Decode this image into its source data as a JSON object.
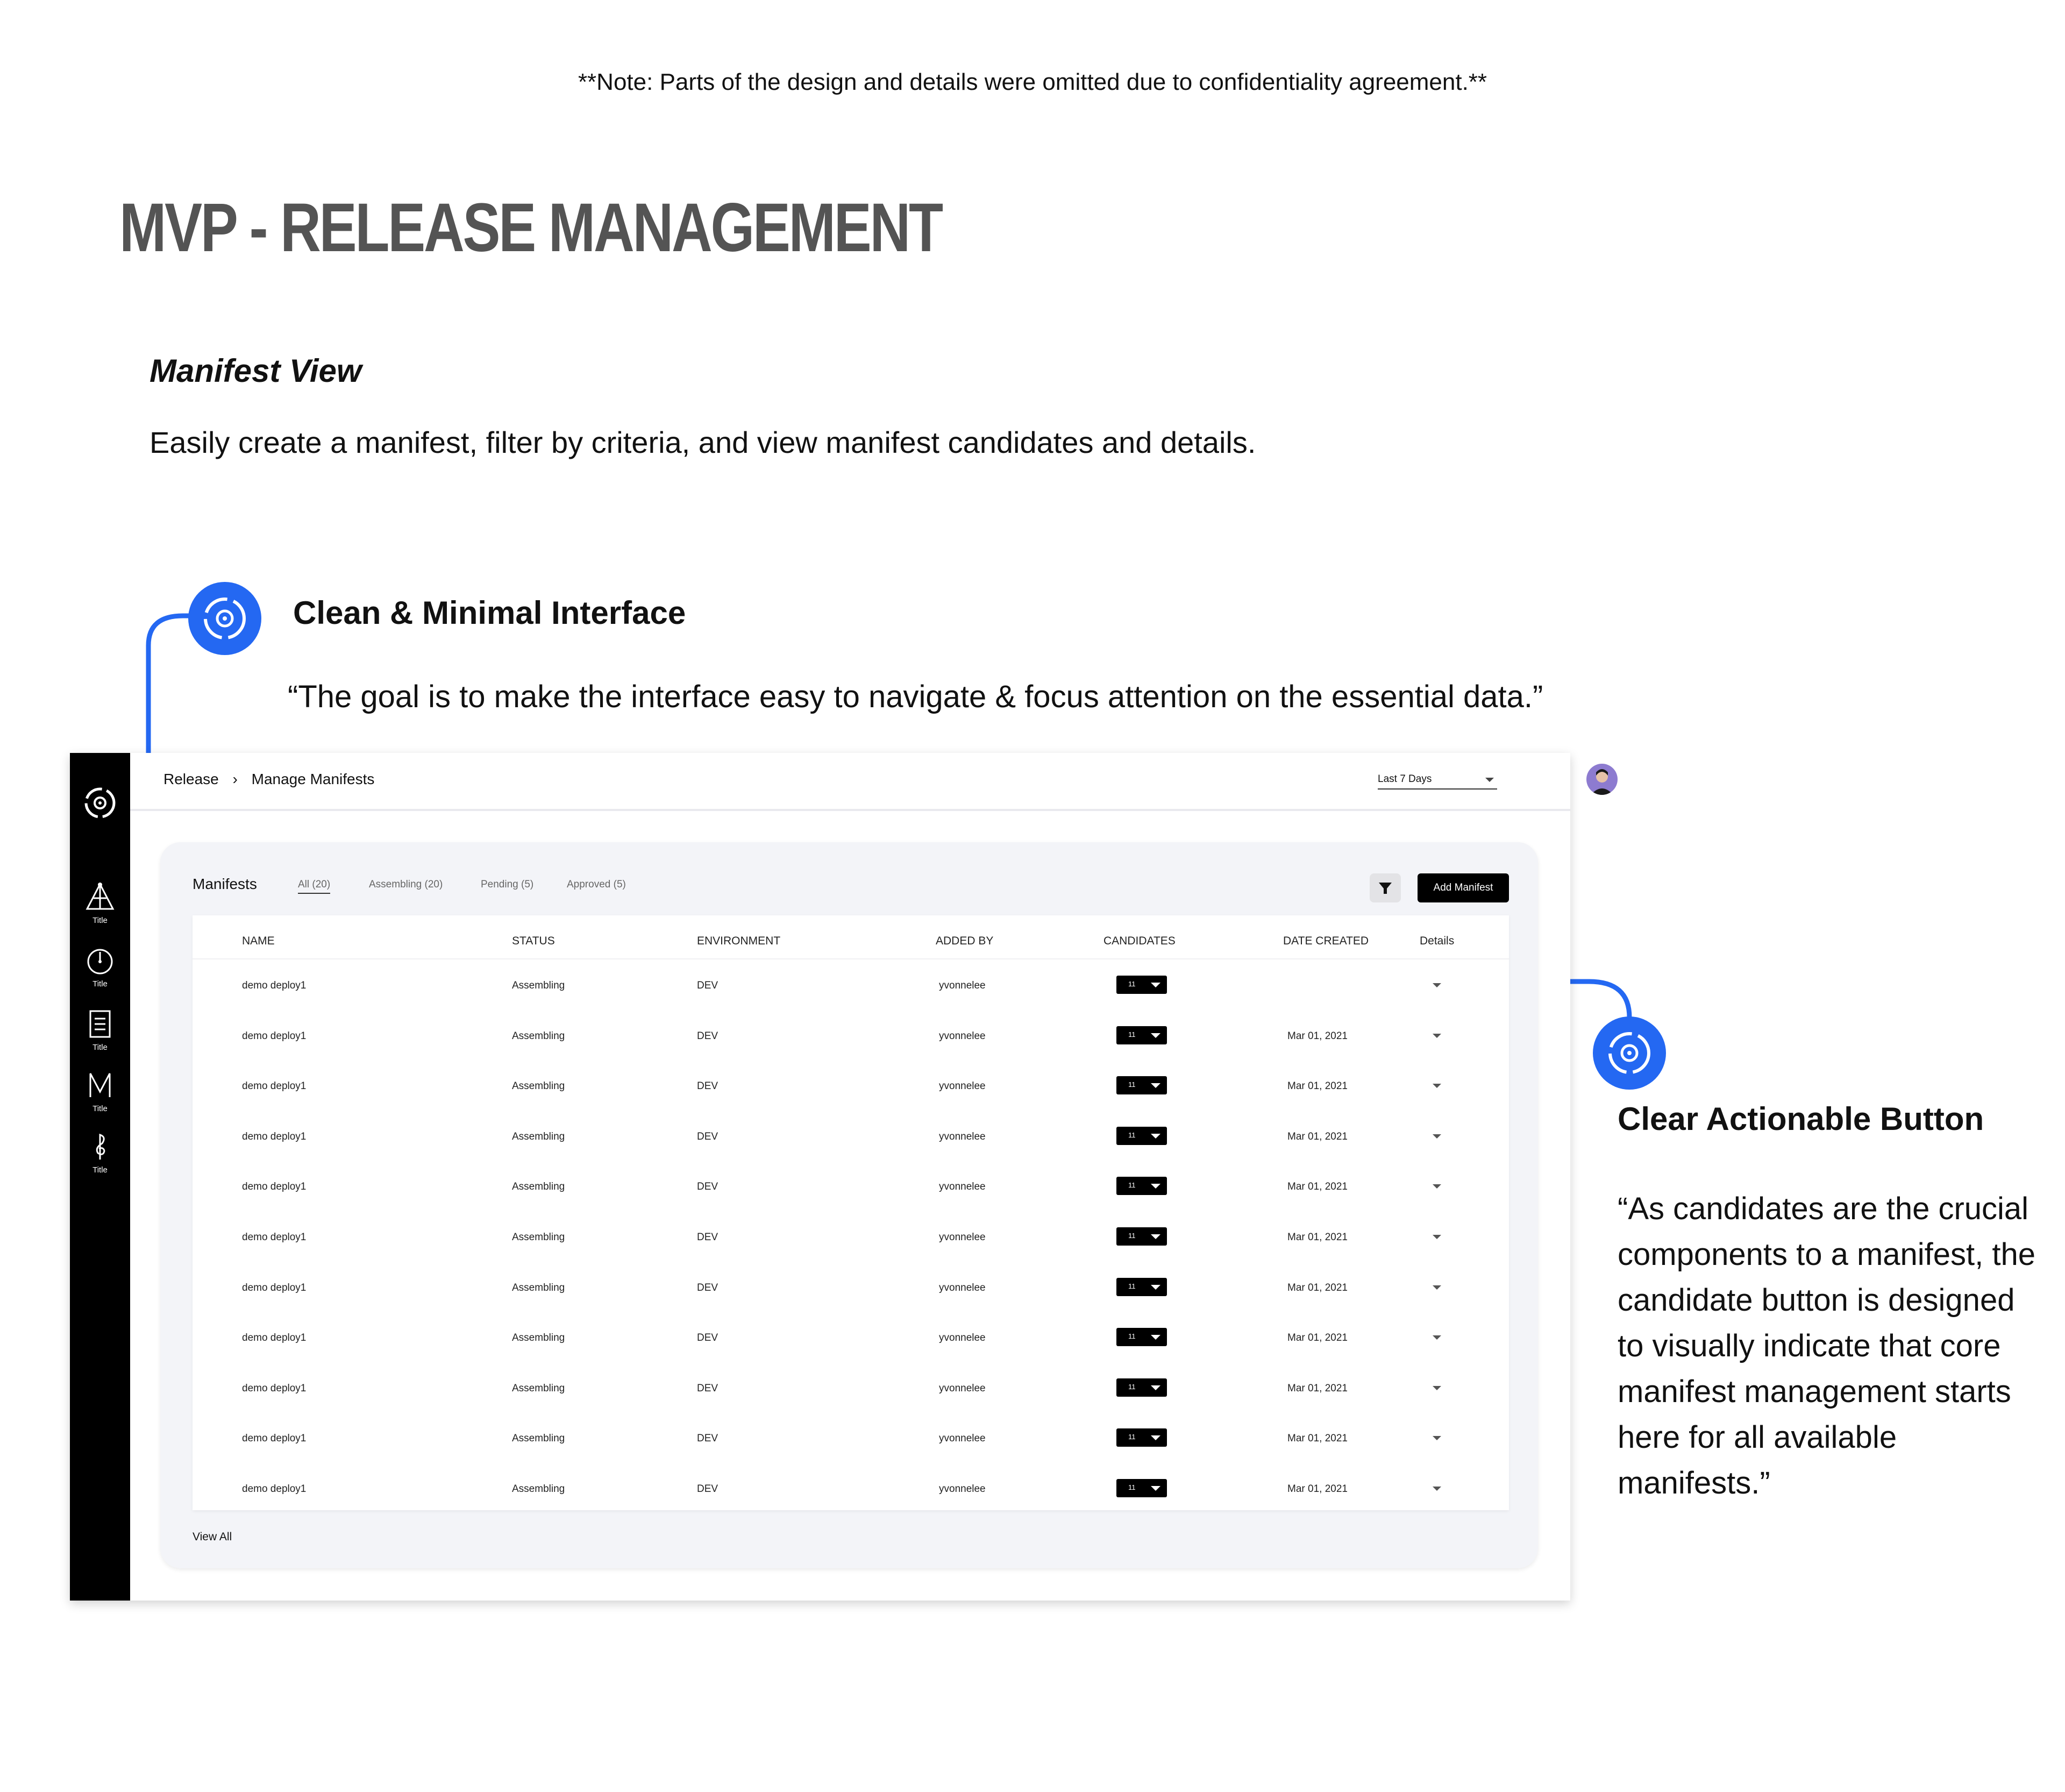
{
  "note": "**Note: Parts of the design and details were omitted due to confidentiality agreement.**",
  "page_title": "MVP - RELEASE MANAGEMENT",
  "section": {
    "title": "Manifest View",
    "description": "Easily create a manifest, filter by criteria, and view manifest candidates and details."
  },
  "callout1": {
    "title": "Clean & Minimal Interface",
    "quote": "“The goal is to make the interface easy to navigate & focus attention on the essential data.”"
  },
  "callout2": {
    "title": "Clear Actionable Button",
    "quote": "“As candidates are the crucial components to a manifest, the candidate button is designed to visually indicate that core manifest management starts here for all available manifests.”"
  },
  "accent_color": "#2468f2",
  "app": {
    "sidebar": {
      "items": [
        {
          "label": "Title",
          "icon": "triangle-tree-icon"
        },
        {
          "label": "Title",
          "icon": "clock-dial-icon"
        },
        {
          "label": "Title",
          "icon": "document-list-icon"
        },
        {
          "label": "Title",
          "icon": "letter-m-icon"
        },
        {
          "label": "Title",
          "icon": "treble-clef-icon"
        }
      ]
    },
    "breadcrumb": {
      "root": "Release",
      "separator": "›",
      "current": "Manage Manifests"
    },
    "period_select": "Last 7 Days",
    "panel": {
      "title": "Manifests",
      "tabs": [
        "All (20)",
        "Assembling (20)",
        "Pending (5)",
        "Approved (5)"
      ],
      "add_button": "Add Manifest",
      "view_all": "View All"
    },
    "table": {
      "columns": [
        "NAME",
        "STATUS",
        "ENVIRONMENT",
        "ADDED BY",
        "CANDIDATES",
        "DATE CREATED",
        "Details"
      ],
      "rows": [
        {
          "name": "demo deploy1",
          "status": "Assembling",
          "environment": "DEV",
          "added_by": "yvonnelee",
          "candidates": "11",
          "date": ""
        },
        {
          "name": "demo deploy1",
          "status": "Assembling",
          "environment": "DEV",
          "added_by": "yvonnelee",
          "candidates": "11",
          "date": "Mar 01, 2021"
        },
        {
          "name": "demo deploy1",
          "status": "Assembling",
          "environment": "DEV",
          "added_by": "yvonnelee",
          "candidates": "11",
          "date": "Mar 01, 2021"
        },
        {
          "name": "demo deploy1",
          "status": "Assembling",
          "environment": "DEV",
          "added_by": "yvonnelee",
          "candidates": "11",
          "date": "Mar 01, 2021"
        },
        {
          "name": "demo deploy1",
          "status": "Assembling",
          "environment": "DEV",
          "added_by": "yvonnelee",
          "candidates": "11",
          "date": "Mar 01, 2021"
        },
        {
          "name": "demo deploy1",
          "status": "Assembling",
          "environment": "DEV",
          "added_by": "yvonnelee",
          "candidates": "11",
          "date": "Mar 01, 2021"
        },
        {
          "name": "demo deploy1",
          "status": "Assembling",
          "environment": "DEV",
          "added_by": "yvonnelee",
          "candidates": "11",
          "date": "Mar 01, 2021"
        },
        {
          "name": "demo deploy1",
          "status": "Assembling",
          "environment": "DEV",
          "added_by": "yvonnelee",
          "candidates": "11",
          "date": "Mar 01, 2021"
        },
        {
          "name": "demo deploy1",
          "status": "Assembling",
          "environment": "DEV",
          "added_by": "yvonnelee",
          "candidates": "11",
          "date": "Mar 01, 2021"
        },
        {
          "name": "demo deploy1",
          "status": "Assembling",
          "environment": "DEV",
          "added_by": "yvonnelee",
          "candidates": "11",
          "date": "Mar 01, 2021"
        },
        {
          "name": "demo deploy1",
          "status": "Assembling",
          "environment": "DEV",
          "added_by": "yvonnelee",
          "candidates": "11",
          "date": "Mar 01, 2021"
        }
      ]
    }
  }
}
